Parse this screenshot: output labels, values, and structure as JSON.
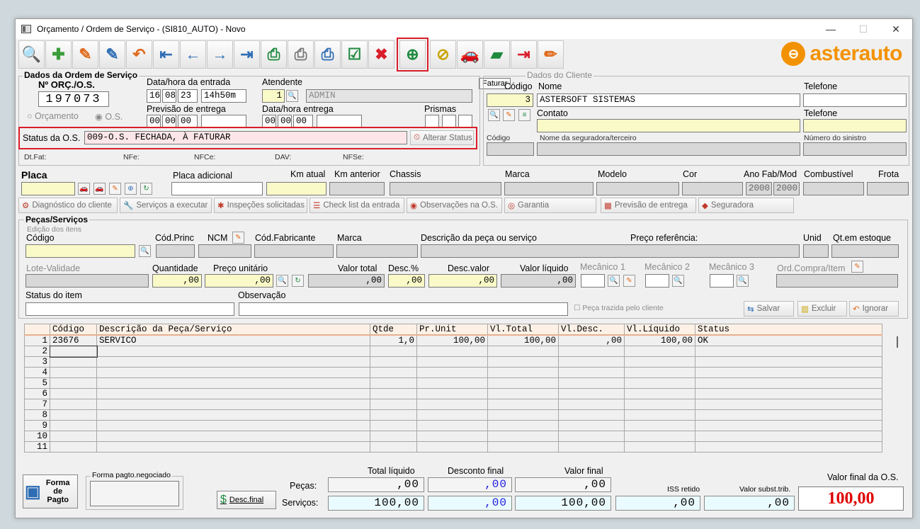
{
  "window": {
    "title": "Orçamento / Ordem de Serviço - (SI810_AUTO) - Novo",
    "minimize": "—",
    "maximize": "☐",
    "close": "✕"
  },
  "toolbar": {
    "tooltip": "Faturar",
    "buttons": [
      {
        "name": "consultar-icon",
        "glyph": "🔍",
        "color": "#2e6db4"
      },
      {
        "name": "novo-icon",
        "glyph": "✚",
        "color": "#3a9d3a"
      },
      {
        "name": "editar-icon",
        "glyph": "✎",
        "color": "#e06a1c"
      },
      {
        "name": "alterar-icon",
        "glyph": "✎",
        "color": "#2e6db4"
      },
      {
        "name": "desfazer-icon",
        "glyph": "↶",
        "color": "#e06a1c"
      },
      {
        "name": "primeiro-icon",
        "glyph": "⇤",
        "color": "#2e6db4"
      },
      {
        "name": "anterior-icon",
        "glyph": "←",
        "color": "#2e6db4"
      },
      {
        "name": "proximo-icon",
        "glyph": "→",
        "color": "#2e6db4"
      },
      {
        "name": "ultimo-icon",
        "glyph": "⇥",
        "color": "#2e6db4"
      },
      {
        "name": "imprimir-icon",
        "glyph": "⎙",
        "color": "#1e8a3e"
      },
      {
        "name": "imprimir2-icon",
        "glyph": "⎙",
        "color": "#777777"
      },
      {
        "name": "imprimir3-icon",
        "glyph": "⎙",
        "color": "#2e6db4"
      },
      {
        "name": "checklist-icon",
        "glyph": "☑",
        "color": "#1e8a3e"
      },
      {
        "name": "excluir-icon",
        "glyph": "✖",
        "color": "#d91e2a"
      },
      {
        "name": "faturar-icon",
        "glyph": "⊕",
        "color": "#1e8a3e"
      },
      {
        "name": "financeiro-icon",
        "glyph": "⊘",
        "color": "#c9a400"
      },
      {
        "name": "veiculo-icon",
        "glyph": "🚗",
        "color": "#2e6db4"
      },
      {
        "name": "pasta-icon",
        "glyph": "▰",
        "color": "#1e8a3e"
      },
      {
        "name": "sair-icon",
        "glyph": "⇥",
        "color": "#d91e2a"
      },
      {
        "name": "lapis-icon",
        "glyph": "✏",
        "color": "#e06a1c"
      }
    ]
  },
  "logo": {
    "text": "asterauto"
  },
  "dados_os": {
    "title": "Dados da Ordem de Serviço",
    "num_label": "Nº ORÇ./O.S.",
    "num": "197073",
    "radio_orc": "Orçamento",
    "radio_os": "O.S.",
    "entrada_label": "Data/hora da entrada",
    "dia": "16",
    "mes": "08",
    "ano": "23",
    "hora": "14h50m",
    "atendente_label": "Atendente",
    "atendente_cod": "1",
    "atendente_nome": "ADMIN",
    "previsao_label": "Previsão de entrega",
    "data_entrega_label": "Data/hora entrega",
    "prismas_label": "Prismas",
    "prev_d": "00",
    "prev_m": "00",
    "prev_a": "00",
    "ent_d": "00",
    "ent_m": "00",
    "ent_a": "00",
    "status_label": "Status da O.S.",
    "status_value": "009-O.S. FECHADA, À FATURAR",
    "alterar_status": "Alterar Status",
    "dtfat": "Dt.Fat:",
    "nfe": "NFe:",
    "nfce": "NFCe:",
    "dav": "DAV:",
    "nfse": "NFSe:"
  },
  "cliente": {
    "title": "Dados do Cliente",
    "codigo_label": "Código",
    "codigo": "3",
    "nome_label": "Nome",
    "nome": "ASTERSOFT SISTEMAS",
    "telefone_label": "Telefone",
    "contato_label": "Contato",
    "telefone2_label": "Telefone",
    "cod_seg_label": "Código",
    "seguradora_label": "Nome da seguradora/terceiro",
    "sinistro_label": "Número do sinistro"
  },
  "veiculo": {
    "placa": "Placa",
    "placa_adicional": "Placa adicional",
    "km_atual": "Km atual",
    "km_anterior": "Km anterior",
    "chassis": "Chassis",
    "marca": "Marca",
    "modelo": "Modelo",
    "cor": "Cor",
    "ano_fab_mod": "Ano Fab/Mod",
    "combustivel": "Combustível",
    "frota": "Frota",
    "ano_fab": "2000",
    "ano_mod": "2000"
  },
  "actions": [
    {
      "label": "Diagnóstico do cliente",
      "icon": "⚙"
    },
    {
      "label": "Serviços a executar",
      "icon": "🔧"
    },
    {
      "label": "Inspeções solicitadas",
      "icon": "✱"
    },
    {
      "label": "Check list da entrada",
      "icon": "☰"
    },
    {
      "label": "Observações na O.S.",
      "icon": "◉"
    },
    {
      "label": "Garantia",
      "icon": "◎"
    },
    {
      "label": "Previsão de entrega",
      "icon": "▦"
    },
    {
      "label": "Seguradora",
      "icon": "◆"
    }
  ],
  "pecas": {
    "title": "Peças/Serviços",
    "edicao": "Edição dos itens",
    "codigo": "Código",
    "cod_princ": "Cód.Princ",
    "ncm": "NCM",
    "cod_fab": "Cód.Fabricante",
    "marca": "Marca",
    "descricao": "Descrição da peça ou serviço",
    "preco_ref": "Preço referência:",
    "unid": "Unid",
    "qt_estoque": "Qt.em estoque",
    "lote": "Lote-Validade",
    "quantidade": "Quantidade",
    "preco_unit": "Preço unitário",
    "valor_total": "Valor total",
    "desc_pct": "Desc.%",
    "desc_valor": "Desc.valor",
    "valor_liquido": "Valor líquido",
    "mec1": "Mecânico 1",
    "mec2": "Mecânico 2",
    "mec3": "Mecânico 3",
    "ord_compra": "Ord.Compra/Item",
    "qtd_val": ",00",
    "preco_val": ",00",
    "total_val": ",00",
    "descpct_val": ",00",
    "descval_val": ",00",
    "liq_val": ",00",
    "status_item": "Status do item",
    "observacao": "Observação",
    "peca_trazida": "Peça trazida pelo cliente",
    "salvar": "Salvar",
    "excluir": "Excluir",
    "ignorar": "Ignorar"
  },
  "grid": {
    "headers": [
      "Código",
      "Descrição da Peça/Serviço",
      "Qtde",
      "Pr.Unit",
      "Vl.Total",
      "Vl.Desc.",
      "Vl.Líquido",
      "Status"
    ],
    "rows": [
      {
        "n": "1",
        "cells": [
          "23676",
          "SERVICO",
          "1,0",
          "100,00",
          "100,00",
          ",00",
          "100,00",
          "OK"
        ]
      },
      {
        "n": "2",
        "cells": [
          "",
          "",
          "",
          "",
          "",
          "",
          "",
          ""
        ]
      },
      {
        "n": "3",
        "cells": [
          "",
          "",
          "",
          "",
          "",
          "",
          "",
          ""
        ]
      },
      {
        "n": "4",
        "cells": [
          "",
          "",
          "",
          "",
          "",
          "",
          "",
          ""
        ]
      },
      {
        "n": "5",
        "cells": [
          "",
          "",
          "",
          "",
          "",
          "",
          "",
          ""
        ]
      },
      {
        "n": "6",
        "cells": [
          "",
          "",
          "",
          "",
          "",
          "",
          "",
          ""
        ]
      },
      {
        "n": "7",
        "cells": [
          "",
          "",
          "",
          "",
          "",
          "",
          "",
          ""
        ]
      },
      {
        "n": "8",
        "cells": [
          "",
          "",
          "",
          "",
          "",
          "",
          "",
          ""
        ]
      },
      {
        "n": "9",
        "cells": [
          "",
          "",
          "",
          "",
          "",
          "",
          "",
          ""
        ]
      },
      {
        "n": "10",
        "cells": [
          "",
          "",
          "",
          "",
          "",
          "",
          "",
          ""
        ]
      },
      {
        "n": "11",
        "cells": [
          "",
          "",
          "",
          "",
          "",
          "",
          "",
          ""
        ]
      }
    ]
  },
  "footer": {
    "forma_pagto": "Forma de Pagto",
    "forma_negociado": "Forma pagto.negociado",
    "desc_final": "Desc.final",
    "total_liquido": "Total líquido",
    "desconto_final": "Desconto final",
    "valor_final": "Valor final",
    "pecas": "Peças:",
    "servicos": "Serviços:",
    "pecas_liq": ",00",
    "pecas_desc": ",00",
    "pecas_final": ",00",
    "serv_liq": "100,00",
    "serv_desc": ",00",
    "serv_final": "100,00",
    "iss_retido": "ISS retido",
    "iss_val": ",00",
    "valor_subst": "Valor subst.trib.",
    "subst_val": ",00",
    "valor_final_os": "Valor final da O.S.",
    "valor_final_os_val": "100,00"
  }
}
